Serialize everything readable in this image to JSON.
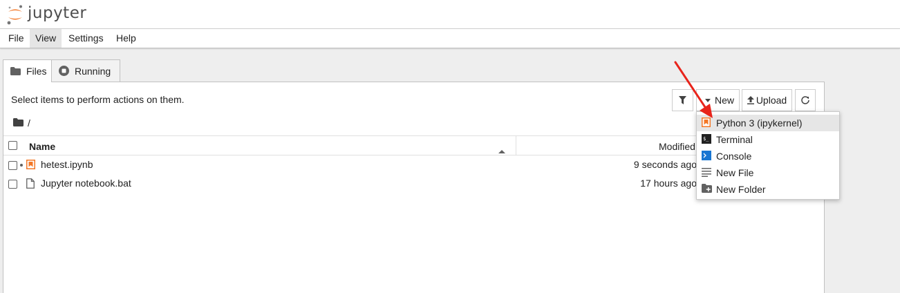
{
  "app": {
    "logo_text": "jupyter",
    "accent_color": "#f37726"
  },
  "menubar": {
    "items": [
      {
        "label": "File"
      },
      {
        "label": "View",
        "active": true
      },
      {
        "label": "Settings"
      },
      {
        "label": "Help"
      }
    ]
  },
  "tabs": [
    {
      "label": "Files",
      "icon": "folder-icon",
      "active": true
    },
    {
      "label": "Running",
      "icon": "stop-circle-icon",
      "active": false
    }
  ],
  "toolbar": {
    "info_text": "Select items to perform actions on them.",
    "new_label": "New",
    "upload_label": "Upload",
    "filter_icon": "filter-icon",
    "refresh_icon": "refresh-icon"
  },
  "breadcrumb": {
    "path": "/"
  },
  "table": {
    "columns": {
      "name": "Name",
      "modified": "Modified"
    },
    "rows": [
      {
        "name": "hetest.ipynb",
        "modified": "9 seconds ago",
        "type": "notebook",
        "running": true
      },
      {
        "name": "Jupyter notebook.bat",
        "modified": "17 hours ago",
        "type": "file",
        "running": false
      }
    ]
  },
  "new_menu": {
    "items": [
      {
        "label": "Python 3 (ipykernel)",
        "icon": "notebook-icon",
        "highlighted": true
      },
      {
        "label": "Terminal",
        "icon": "terminal-icon"
      },
      {
        "label": "Console",
        "icon": "console-icon"
      },
      {
        "label": "New File",
        "icon": "text-file-icon"
      },
      {
        "label": "New Folder",
        "icon": "new-folder-icon"
      }
    ]
  },
  "annotation": {
    "arrow_color": "#e8241b"
  }
}
